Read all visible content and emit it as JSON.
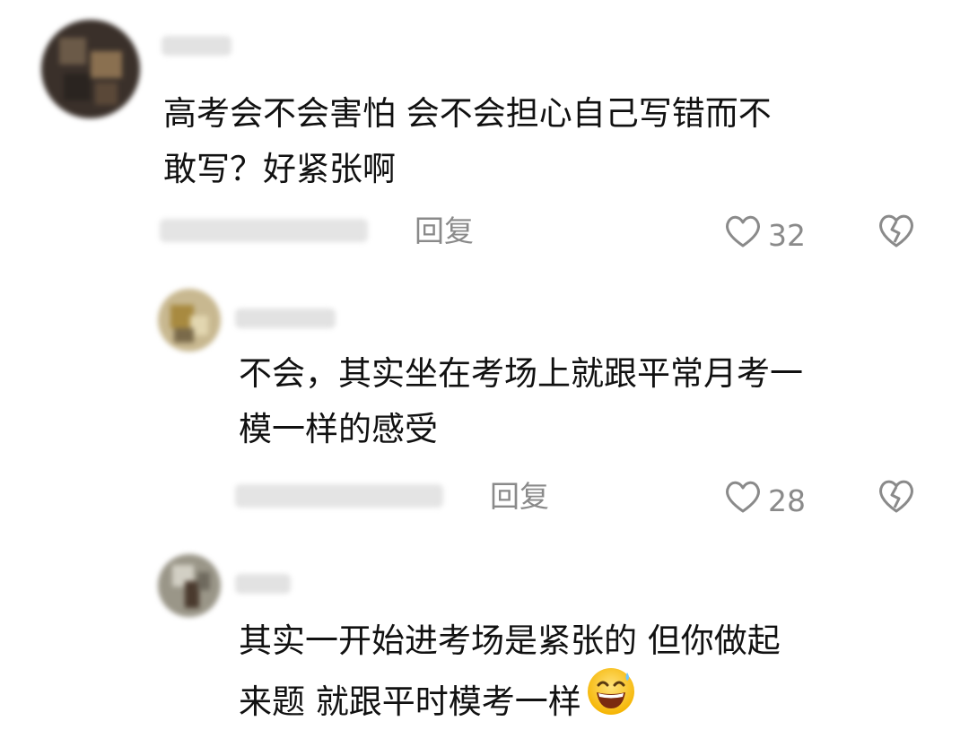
{
  "comments": [
    {
      "text": "高考会不会害怕 会不会担心自己写错而不\n敢写？好紧张啊",
      "reply_label": "回复",
      "like_count": "32"
    },
    {
      "text": "不会，其实坐在考场上就跟平常月考一\n模一样的感受",
      "reply_label": "回复",
      "like_count": "28"
    },
    {
      "text": "其实一开始进考场是紧张的 但你做起\n来题 就跟平时模考一样",
      "emoji": "grinning-sweat-emoji"
    }
  ],
  "icons": {
    "like": "heart-outline-icon",
    "dislike": "broken-heart-icon"
  },
  "colors": {
    "text": "#111111",
    "meta": "#8a8a8a",
    "background": "#ffffff"
  }
}
